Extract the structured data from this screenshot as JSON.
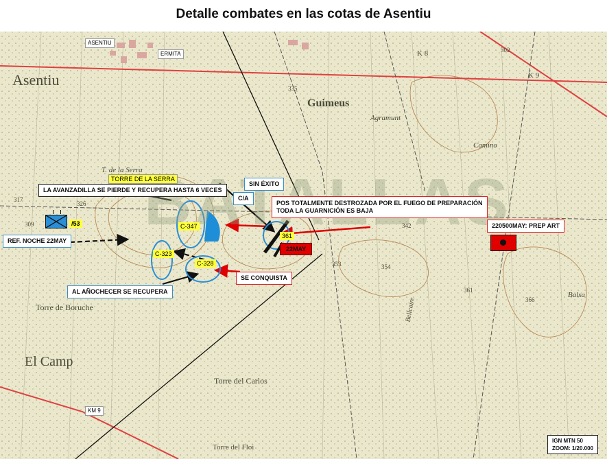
{
  "title": "Detalle combates en las cotas de Asentiu",
  "map_labels": {
    "asentiu_tag": "ASENTIU",
    "ermita": "ERMITA",
    "torre_de_la_serra": "TORRE DE LA SERRA",
    "km9_tag": "KM 9"
  },
  "places": {
    "asentiu": "Asentiu",
    "guimeus": "Guimeus",
    "torre_serra": "T. de la Serra",
    "torre_boruche": "Torre de Boruche",
    "el_camp": "El    Camp",
    "torre_carlos": "Torre del Carlos",
    "torre_floi": "Torre del Floi",
    "agramunt": "Agramunt",
    "balsa": "Balsa",
    "k8": "K 8",
    "k9": "K 9",
    "camino": "Camino",
    "bellcaire": "Bellcaire"
  },
  "elevations": [
    "317",
    "326",
    "309",
    "335",
    "302",
    "342",
    "353",
    "354",
    "361",
    "366"
  ],
  "heights": {
    "c347": "C-347",
    "c323": "C-323",
    "c328": "C-328",
    "h361": "361"
  },
  "callouts": {
    "avanzadilla": "LA AVANZADILLA SE PIERDE Y RECUPERA HASTA 6 VECES",
    "ref_noche": "REF. NOCHE 22MAY",
    "anochecer": "AL AÑOCHECER SE RECUPERA",
    "se_conquista": "SE CONQUISTA",
    "sin_exito": "SIN ÉXITO",
    "ca": "C/A",
    "pos_destrozada_1": "POS TOTALMENTE DESTROZADA POR EL FUEGO DE PREPARACIÓN",
    "pos_destrozada_2": "TODA LA GUARNICIÓN ES BAJA",
    "prep_art": "220500MAY: PREP ART",
    "date_22may": "22MAY"
  },
  "unit": {
    "label": "/53"
  },
  "watermark": "BATALLAS",
  "info_box": {
    "source": "IGN MTN 50",
    "zoom": "ZOOM: 1/20.000"
  },
  "colors": {
    "friendly": "#2a8fd6",
    "enemy": "#e00000",
    "highlight": "#ffff00",
    "front_line": "#111111",
    "road": "#e04040"
  }
}
